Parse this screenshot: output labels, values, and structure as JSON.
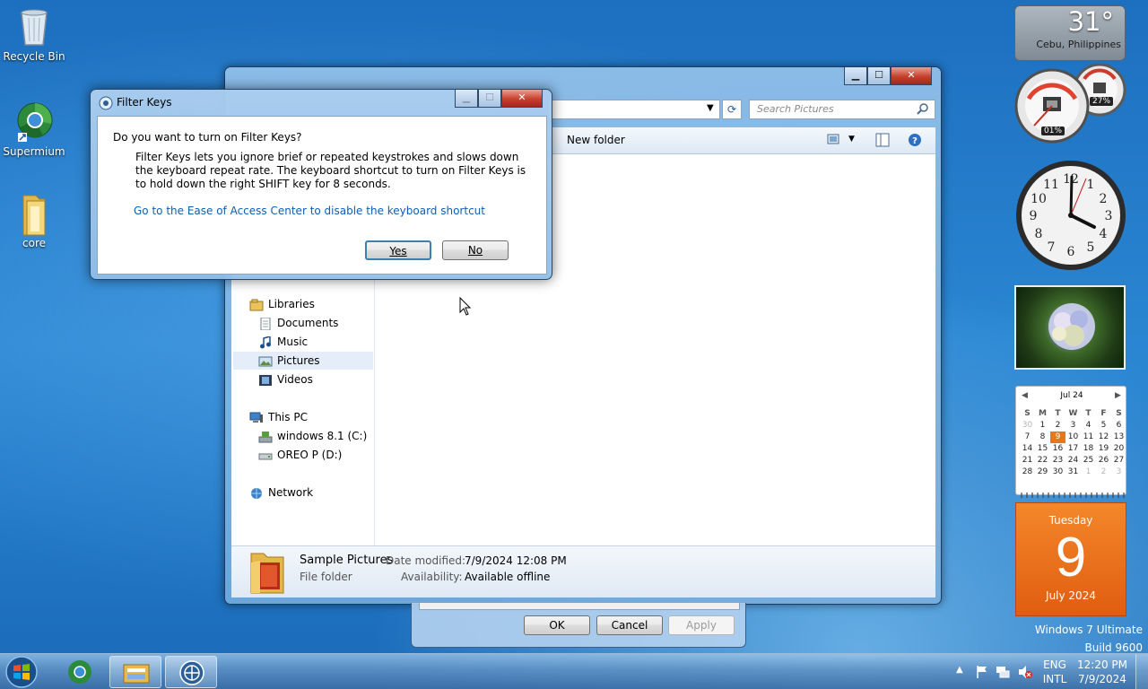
{
  "desktop": {
    "icons": [
      {
        "label": "Recycle Bin"
      },
      {
        "label": "Supermium"
      },
      {
        "label": "core"
      }
    ],
    "watermark_line1": "Windows 7 Ultimate",
    "watermark_line2": "Build 9600"
  },
  "explorer": {
    "search_placeholder": "Search Pictures",
    "toolbar_new_folder": "New folder",
    "nav": {
      "libraries": "Libraries",
      "documents": "Documents",
      "music": "Music",
      "pictures": "Pictures",
      "videos": "Videos",
      "this_pc": "This PC",
      "drive_c": "windows 8.1 (C:)",
      "drive_d": "OREO P (D:)",
      "network": "Network"
    },
    "details": {
      "name": "Sample Pictures",
      "type": "File folder",
      "date_modified_label": "Date modified:",
      "date_modified_value": "7/9/2024 12:08 PM",
      "availability_label": "Availability:",
      "availability_value": "Available offline"
    }
  },
  "properties_dialog": {
    "ok": "OK",
    "cancel": "Cancel",
    "apply": "Apply"
  },
  "filter_keys_dialog": {
    "title": "Filter Keys",
    "question": "Do you want to turn on Filter Keys?",
    "description": "Filter Keys lets you ignore brief or repeated keystrokes and slows down the keyboard repeat rate.  The keyboard shortcut to turn on Filter Keys is to hold down the right SHIFT key for 8 seconds.",
    "link": "Go to the Ease of Access Center to disable the keyboard shortcut",
    "yes": "Yes",
    "no": "No"
  },
  "gadgets": {
    "weather": {
      "temperature": "31°",
      "location": "Cebu, Philippines"
    },
    "meter": {
      "cpu": "01%",
      "memory": "27%"
    },
    "calendar": {
      "month_label": "Jul 24",
      "weekdays": [
        "S",
        "M",
        "T",
        "W",
        "T",
        "F",
        "S"
      ],
      "weeks": [
        [
          "30",
          "1",
          "2",
          "3",
          "4",
          "5",
          "6"
        ],
        [
          "7",
          "8",
          "9",
          "10",
          "11",
          "12",
          "13"
        ],
        [
          "14",
          "15",
          "16",
          "17",
          "18",
          "19",
          "20"
        ],
        [
          "21",
          "22",
          "23",
          "24",
          "25",
          "26",
          "27"
        ],
        [
          "28",
          "29",
          "30",
          "31",
          "1",
          "2",
          "3"
        ]
      ],
      "today": "9",
      "day_name": "Tuesday",
      "day_number": "9",
      "month_year": "July 2024"
    }
  },
  "taskbar": {
    "lang": "ENG",
    "layout": "INTL",
    "time": "12:20 PM",
    "date": "7/9/2024"
  },
  "colors": {
    "accent_orange": "#e27a1d",
    "link_blue": "#0b5fb5"
  }
}
